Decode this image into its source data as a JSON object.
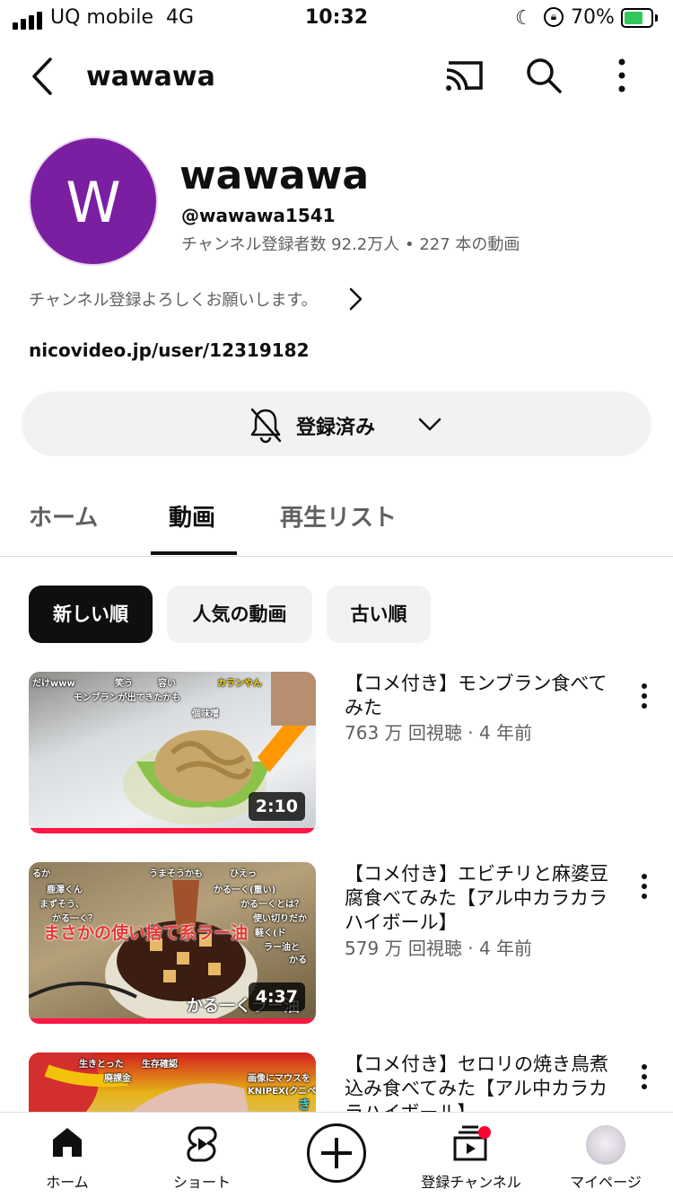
{
  "status_bar": {
    "carrier": "UQ mobile",
    "network": "4G",
    "time": "10:32",
    "battery_percent": "70%",
    "battery_level": 0.7,
    "icons": [
      "signal-icon",
      "moon-icon",
      "orientation-lock-icon",
      "battery-charging-icon"
    ]
  },
  "top_bar": {
    "title": "wawawa",
    "icons": [
      "back-arrow-icon",
      "cast-icon",
      "search-icon",
      "more-vert-icon"
    ]
  },
  "channel": {
    "avatar_letter": "W",
    "avatar_color": "#7b1fa2",
    "name": "wawawa",
    "handle": "@wawawa1541",
    "stats": "チャンネル登録者数 92.2万人 • 227 本の動画",
    "description": "チャンネル登録よろしくお願いします。",
    "link": "nicovideo.jp/user/12319182",
    "subscribe_label": "登録済み"
  },
  "tabs": [
    {
      "label": "ホーム",
      "active": false
    },
    {
      "label": "動画",
      "active": true
    },
    {
      "label": "再生リスト",
      "active": false
    }
  ],
  "chips": [
    {
      "label": "新しい順",
      "active": true
    },
    {
      "label": "人気の動画",
      "active": false
    },
    {
      "label": "古い順",
      "active": false
    }
  ],
  "videos": [
    {
      "title": "【コメ付き】モンブラン食べてみた",
      "meta": "763 万 回視聴 · 4 年前",
      "duration": "2:10",
      "overlay": [
        "だけwww",
        "笑う",
        "容い",
        "カランやん",
        "モンブランが出てきたかも",
        "個味噌"
      ]
    },
    {
      "title": "【コメ付き】エビチリと麻婆豆腐食べてみた【アル中カラカラハイボール】",
      "meta": "579 万 回視聴 · 4 年前",
      "duration": "4:37",
      "overlay": [
        "るか",
        "うまそうかも",
        "ひえっ",
        "鹿澤くん",
        "かる一く(重い)",
        "まずそう、",
        "かる一くとは？",
        "かる一く？",
        "使い切りだか",
        "軽く(ド",
        "ラー油と",
        "かる",
        "まさかの使い捨て系ラー油",
        "かる一くラー油"
      ]
    },
    {
      "title": "【コメ付き】セロリの焼き鳥煮込み食べてみた【アル中カラカラハイボール】",
      "meta": "",
      "duration": "",
      "overlay": [
        "生きとった",
        "生存確認",
        "廃課金",
        "画像にマウスを",
        "KNIPEX(クニペ",
        "き"
      ]
    }
  ],
  "bottom_nav": [
    {
      "label": "ホーム",
      "icon": "home-icon"
    },
    {
      "label": "ショート",
      "icon": "shorts-icon"
    },
    {
      "label": "",
      "icon": "create-plus-icon"
    },
    {
      "label": "登録チャンネル",
      "icon": "subscriptions-icon"
    },
    {
      "label": "マイページ",
      "icon": "profile-avatar-icon"
    }
  ],
  "colors": {
    "progress_red": "#ff1744",
    "chip_active_bg": "#0f0f0f",
    "chip_bg": "#f2f2f2",
    "secondary_text": "#606060"
  }
}
